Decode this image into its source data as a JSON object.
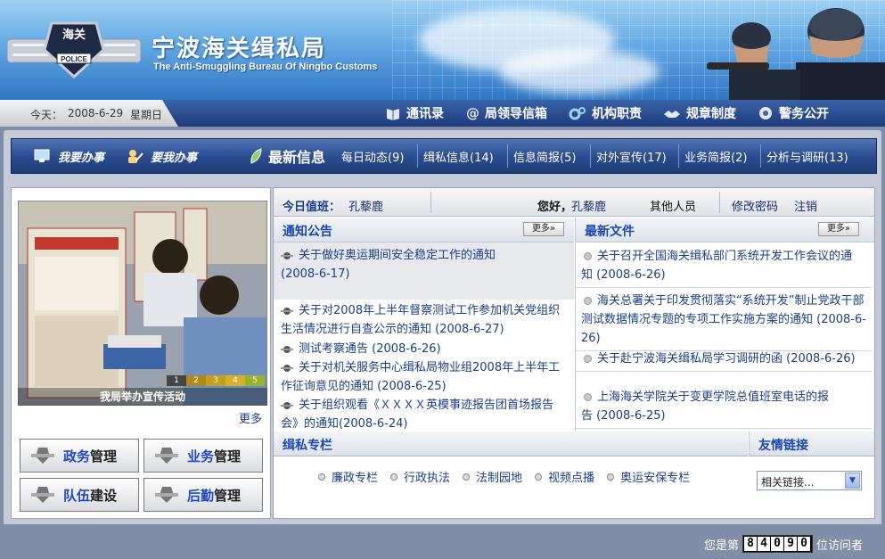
{
  "header": {
    "title": "宁波海关缉私局",
    "subtitle": "The Anti-Smuggling Bureau Of Ningbo Customs",
    "emblem_top": "海关",
    "emblem_bottom": "POLICE"
  },
  "topbar": {
    "date_label": "今天：",
    "date": "2008-6-29",
    "weekday": "星期日",
    "nav": [
      {
        "label": "通讯录",
        "icon": "book-icon"
      },
      {
        "label": "局领导信箱",
        "icon": "at-icon"
      },
      {
        "label": "机构职责",
        "icon": "gears-icon"
      },
      {
        "label": "规章制度",
        "icon": "handshake-icon"
      },
      {
        "label": "警务公开",
        "icon": "shield-icon"
      }
    ]
  },
  "subnav": {
    "my_work": "我要办事",
    "request_work": "要我办事",
    "latest": "最新信息",
    "items": [
      "每日动态(9)",
      "缉私信息(14)",
      "信息简报(5)",
      "对外宣传(17)",
      "业务简报(2)",
      "分析与调研(13)"
    ]
  },
  "photo": {
    "caption": "我局举办宣传活动",
    "pages": [
      "1",
      "2",
      "3",
      "4",
      "5"
    ],
    "more": "更多"
  },
  "management": [
    {
      "accent": "政务",
      "rest": "管理"
    },
    {
      "accent": "业务",
      "rest": "管理"
    },
    {
      "accent": "队伍",
      "rest": "建设"
    },
    {
      "accent": "后勤",
      "rest": "管理"
    }
  ],
  "userbar": {
    "duty_label": "今日值班：",
    "duty_name": "孔藜鹿",
    "greeting": "您好，",
    "user_name": "孔藜鹿",
    "other_people": "其他人员",
    "change_password": "修改密码",
    "logout": "注销"
  },
  "notices": {
    "title": "通知公告",
    "more": "更多»",
    "items": [
      {
        "text": "关于做好奥运期间安全稳定工作的通知",
        "date": "(2008-6-17)"
      },
      {
        "text": "关于对2008年上半年督察测试工作参加机关党组织生活情况进行自查公示的通知",
        "date": "(2008-6-27)"
      },
      {
        "text": "测试考察通告",
        "date": "(2008-6-26)"
      },
      {
        "text": "关于对机关服务中心缉私局物业组2008年上半年工作征询意见的通知",
        "date": "(2008-6-25)"
      },
      {
        "text": "关于组织观看《ＸＸＸＸ英模事迹报告团首场报告会》的通知",
        "date": "(2008-6-24)"
      }
    ]
  },
  "files": {
    "title": "最新文件",
    "more": "更多»",
    "items": [
      {
        "text": "关于召开全国海关缉私部门系统开发工作会议的通知",
        "date": "(2008-6-26)"
      },
      {
        "text": "海关总署关于印发贯彻落实“系统开发”制止党政干部测试数据情况专题的专项工作实施方案的通知",
        "date": "(2008-6-26)"
      },
      {
        "text": "关于赴宁波海关缉私局学习调研的函",
        "date": "(2008-6-26)"
      },
      {
        "text": "上海海关学院关于变更学院总值班室电话的报告",
        "date": "(2008-6-25)"
      }
    ]
  },
  "columns": {
    "title": "缉私专栏",
    "links": [
      "廉政专栏",
      "行政执法",
      "法制园地",
      "视频点播",
      "奥运安保专栏"
    ]
  },
  "friend_links": {
    "title": "友情链接",
    "selected": "相关链接..."
  },
  "footer": {
    "prefix": "您是第",
    "digits": [
      "8",
      "4",
      "0",
      "9",
      "0"
    ],
    "suffix": "位访问者"
  },
  "colors": {
    "nav_dark": "#1f3d7a",
    "link_blue": "#1a3c8a",
    "heading_blue": "#1d47b0",
    "panel_gray": "#c5cbd6"
  }
}
